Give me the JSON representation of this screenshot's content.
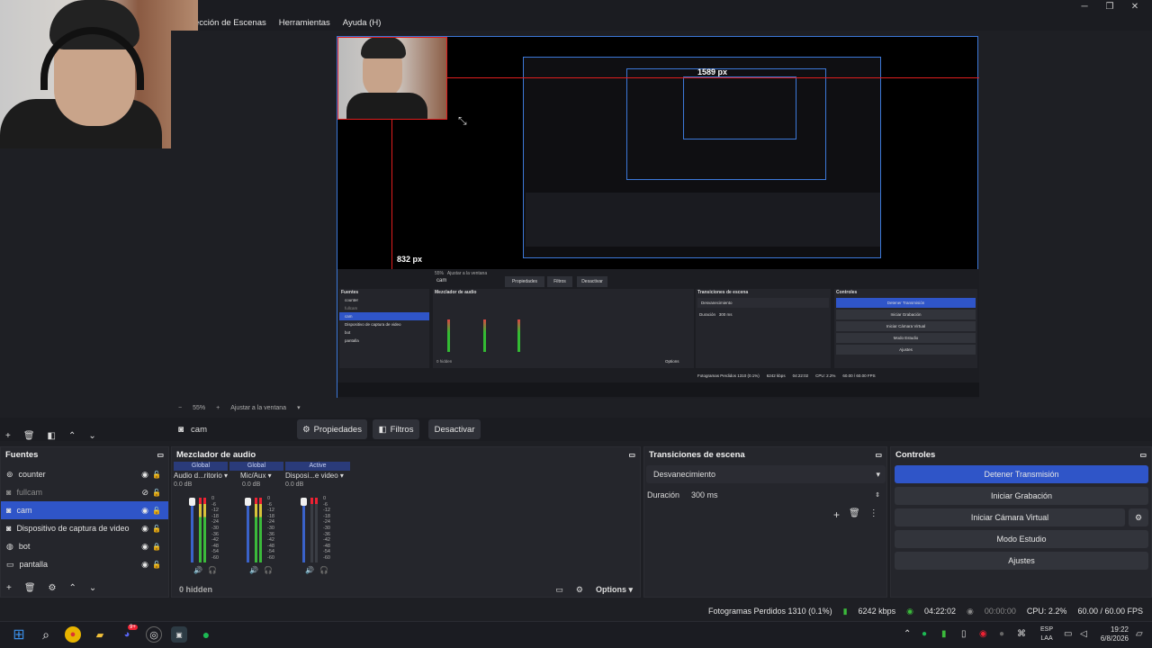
{
  "menu": [
    "ección de Escenas",
    "Herramientas",
    "Ayuda (H)"
  ],
  "window_controls": [
    "─",
    "❐",
    "✕"
  ],
  "preview": {
    "label_width": "1589 px",
    "label_height": "832 px",
    "inner_sources": [
      "counter",
      "fullcam",
      "cam",
      "Dispositivo de captura de video",
      "bot",
      "pantalla"
    ],
    "inner_controls": [
      "Detener Transmisión",
      "Iniciar Grabación",
      "Iniciar Cámara Virtual",
      "Modo Estudio",
      "Ajustes"
    ],
    "inner_docks": {
      "sources": "Fuentes",
      "mixer": "Mezclador de audio",
      "transitions": "Transiciones de escena",
      "controls": "Controles"
    },
    "inner_buttons": [
      "Propiedades",
      "Filtros",
      "Desactivar"
    ],
    "inner_source": "cam",
    "inner_transition": "Desvanecimiento",
    "inner_duration_label": "Duración",
    "inner_duration": "300 ms",
    "inner_hidden": "0 hidden",
    "inner_options": "Options",
    "inner_status": "Fotogramas Perdidos 1310 (0.1%)",
    "inner_kbps": "6242 kbps",
    "inner_time": "04:22:02",
    "inner_cpu": "CPU: 2.2%",
    "inner_fps": "60.00 / 60.00 FPS",
    "inner_zoom": "55%",
    "inner_fit": "Ajustar a la ventana"
  },
  "zoom": {
    "minus": "−",
    "value": "55%",
    "plus": "+",
    "fit": "Ajustar a la ventana"
  },
  "source_toolbar": {
    "source": "cam",
    "properties": "Propiedades",
    "filters": "Filtros",
    "deactivate": "Desactivar"
  },
  "sources_dock": {
    "title": "Fuentes",
    "items": [
      {
        "name": "counter",
        "visible": true,
        "locked": false
      },
      {
        "name": "fullcam",
        "visible": false,
        "locked": false
      },
      {
        "name": "cam",
        "visible": true,
        "locked": false,
        "selected": true
      },
      {
        "name": "Dispositivo de captura de video",
        "visible": true,
        "locked": false
      },
      {
        "name": "bot",
        "visible": true,
        "locked": true
      },
      {
        "name": "pantalla",
        "visible": true,
        "locked": false
      }
    ]
  },
  "mixer": {
    "title": "Mezclador de audio",
    "channels": [
      {
        "header": "Global",
        "name": "Audio d...ritorio",
        "db": "0.0 dB"
      },
      {
        "header": "Global",
        "name": "Mic/Aux",
        "db": "0.0 dB"
      },
      {
        "header": "Active",
        "name": "Disposi...e video",
        "db": "0.0 dB"
      }
    ],
    "scale": [
      "0",
      "-6",
      "-12",
      "-18",
      "-24",
      "-30",
      "-36",
      "-42",
      "-48",
      "-54",
      "-60"
    ],
    "hidden": "0 hidden",
    "options": "Options"
  },
  "transitions": {
    "title": "Transiciones de escena",
    "selected": "Desvanecimiento",
    "duration_label": "Duración",
    "duration": "300 ms"
  },
  "controls": {
    "title": "Controles",
    "stop_stream": "Detener Transmisión",
    "start_recording": "Iniciar Grabación",
    "start_virtualcam": "Iniciar Cámara Virtual",
    "studio_mode": "Modo Estudio",
    "settings": "Ajustes"
  },
  "status": {
    "dropped": "Fotogramas Perdidos 1310 (0.1%)",
    "kbps": "6242 kbps",
    "stream_time": "04:22:02",
    "rec_time": "00:00:00",
    "cpu": "CPU: 2.2%",
    "fps": "60.00 / 60.00 FPS"
  },
  "taskbar": {
    "lang": "ESP",
    "layout": "LAA",
    "time": "19:22",
    "date": "6/8/2026",
    "discord_badge": "9+"
  },
  "colors": {
    "accent": "#2f55c8",
    "red_guide": "#e01e1e",
    "preview_border": "#3c78d8"
  }
}
